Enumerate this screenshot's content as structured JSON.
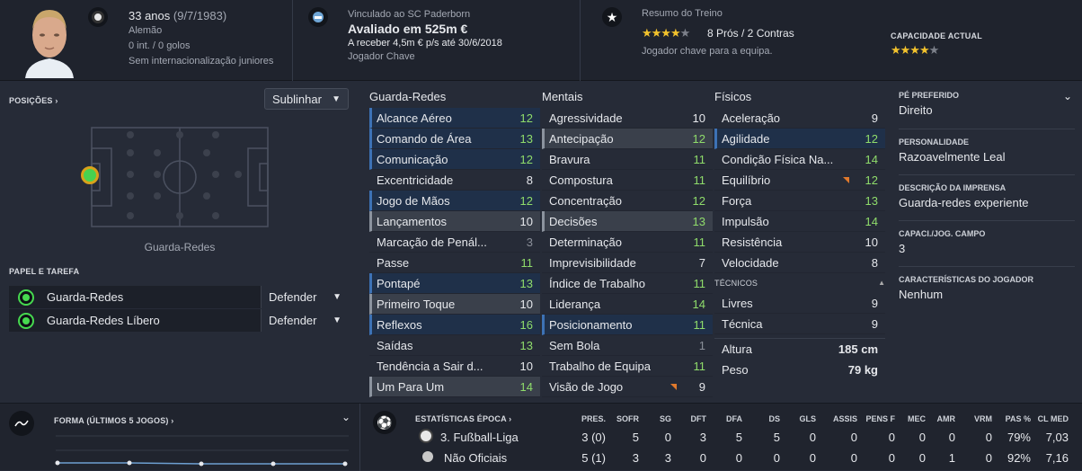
{
  "header": {
    "age": "33 anos",
    "dob": "(9/7/1983)",
    "nationality": "Alemão",
    "caps": "0 int. / 0 golos",
    "youth": "Sem internacionalização juniores",
    "contract_club": "Vinculado ao SC Paderborn",
    "value": "Avaliado em 525m €",
    "wage": "A receber 4,5m € p/s até 30/6/2018",
    "squad_status": "Jogador Chave",
    "training_title": "Resumo do Treino",
    "training_pros": "8 Prós / 2 Contras",
    "training_note": "Jogador chave para a equipa.",
    "training_stars": 4,
    "ability_label": "CAPACIDADE ACTUAL",
    "ability_stars": 4
  },
  "positions": {
    "title": "POSIÇÕES ›",
    "dropdown": "Sublinhar",
    "position_label": "Guarda-Redes"
  },
  "role": {
    "title": "PAPEL E TAREFA",
    "roles": [
      {
        "name": "Guarda-Redes",
        "duty": "Defender"
      },
      {
        "name": "Guarda-Redes Líbero",
        "duty": "Defender"
      }
    ]
  },
  "attributes": {
    "goalkeeping": {
      "title": "Guarda-Redes",
      "items": [
        {
          "n": "Alcance Aéreo",
          "v": "12",
          "hl": "bl"
        },
        {
          "n": "Comando de Área",
          "v": "13",
          "hl": "bl"
        },
        {
          "n": "Comunicação",
          "v": "12",
          "hl": "bl"
        },
        {
          "n": "Excentricidade",
          "v": "8",
          "hl": ""
        },
        {
          "n": "Jogo de Mãos",
          "v": "12",
          "hl": "bl"
        },
        {
          "n": "Lançamentos",
          "v": "10",
          "hl": "gr"
        },
        {
          "n": "Marcação de Penál...",
          "v": "3",
          "hl": ""
        },
        {
          "n": "Passe",
          "v": "11",
          "hl": ""
        },
        {
          "n": "Pontapé",
          "v": "13",
          "hl": "bl"
        },
        {
          "n": "Primeiro Toque",
          "v": "10",
          "hl": "gr"
        },
        {
          "n": "Reflexos",
          "v": "16",
          "hl": "bl"
        },
        {
          "n": "Saídas",
          "v": "13",
          "hl": ""
        },
        {
          "n": "Tendência a Sair d...",
          "v": "10",
          "hl": ""
        },
        {
          "n": "Um Para Um",
          "v": "14",
          "hl": "gr"
        }
      ]
    },
    "mental": {
      "title": "Mentais",
      "items": [
        {
          "n": "Agressividade",
          "v": "10",
          "hl": ""
        },
        {
          "n": "Antecipação",
          "v": "12",
          "hl": "gr"
        },
        {
          "n": "Bravura",
          "v": "11",
          "hl": ""
        },
        {
          "n": "Compostura",
          "v": "11",
          "hl": ""
        },
        {
          "n": "Concentração",
          "v": "12",
          "hl": ""
        },
        {
          "n": "Decisões",
          "v": "13",
          "hl": "gr"
        },
        {
          "n": "Determinação",
          "v": "11",
          "hl": ""
        },
        {
          "n": "Imprevisibilidade",
          "v": "7",
          "hl": ""
        },
        {
          "n": "Índice de Trabalho",
          "v": "11",
          "hl": ""
        },
        {
          "n": "Liderança",
          "v": "14",
          "hl": ""
        },
        {
          "n": "Posicionamento",
          "v": "11",
          "hl": "bl"
        },
        {
          "n": "Sem Bola",
          "v": "1",
          "hl": ""
        },
        {
          "n": "Trabalho de Equipa",
          "v": "11",
          "hl": ""
        },
        {
          "n": "Visão de Jogo",
          "v": "9",
          "hl": "",
          "flag": true
        }
      ]
    },
    "physical": {
      "title": "Físicos",
      "items": [
        {
          "n": "Aceleração",
          "v": "9",
          "hl": ""
        },
        {
          "n": "Agilidade",
          "v": "12",
          "hl": "bl"
        },
        {
          "n": "Condição Física Na...",
          "v": "14",
          "hl": ""
        },
        {
          "n": "Equilíbrio",
          "v": "12",
          "hl": "",
          "flag": true
        },
        {
          "n": "Força",
          "v": "13",
          "hl": ""
        },
        {
          "n": "Impulsão",
          "v": "14",
          "hl": ""
        },
        {
          "n": "Resistência",
          "v": "10",
          "hl": ""
        },
        {
          "n": "Velocidade",
          "v": "8",
          "hl": ""
        }
      ]
    },
    "technical": {
      "title": "TÉCNICOS",
      "items": [
        {
          "n": "Livres",
          "v": "9",
          "hl": ""
        },
        {
          "n": "Técnica",
          "v": "9",
          "hl": ""
        }
      ]
    },
    "height_label": "Altura",
    "height": "185 cm",
    "weight_label": "Peso",
    "weight": "79 kg"
  },
  "info": [
    {
      "h": "PÉ PREFERIDO",
      "t": "Direito"
    },
    {
      "h": "PERSONALIDADE",
      "t": "Razoavelmente Leal"
    },
    {
      "h": "DESCRIÇÃO DA IMPRENSA",
      "t": "Guarda-redes experiente"
    },
    {
      "h": "CAPACI./JOG. CAMPO",
      "t": "3"
    },
    {
      "h": "CARACTERÍSTICAS DO JOGADOR",
      "t": "Nenhum"
    }
  ],
  "form": {
    "title": "FORMA (ÚLTIMOS 5 JOGOS) ›"
  },
  "stats": {
    "title": "ESTATÍSTICAS ÉPOCA ›",
    "columns": [
      "PRES.",
      "SOFR",
      "SG",
      "DFT",
      "DFA",
      "DS",
      "GLS",
      "ASSIS",
      "PENS F",
      "MEC",
      "AMR",
      "VRM",
      "PAS %",
      "CL MED"
    ],
    "rows": [
      {
        "comp": "3. Fußball-Liga",
        "vals": [
          "3 (0)",
          "5",
          "0",
          "3",
          "5",
          "5",
          "0",
          "0",
          "0",
          "0",
          "0",
          "0",
          "79%",
          "7,03"
        ]
      },
      {
        "comp": "Não Oficiais",
        "vals": [
          "5 (1)",
          "3",
          "3",
          "0",
          "0",
          "0",
          "0",
          "0",
          "0",
          "0",
          "1",
          "0",
          "92%",
          "7,16"
        ]
      }
    ]
  },
  "colors": {
    "accent_green": "#8fdc6b",
    "highlight_blue": "#3d72b5",
    "star": "#f2c22d"
  }
}
